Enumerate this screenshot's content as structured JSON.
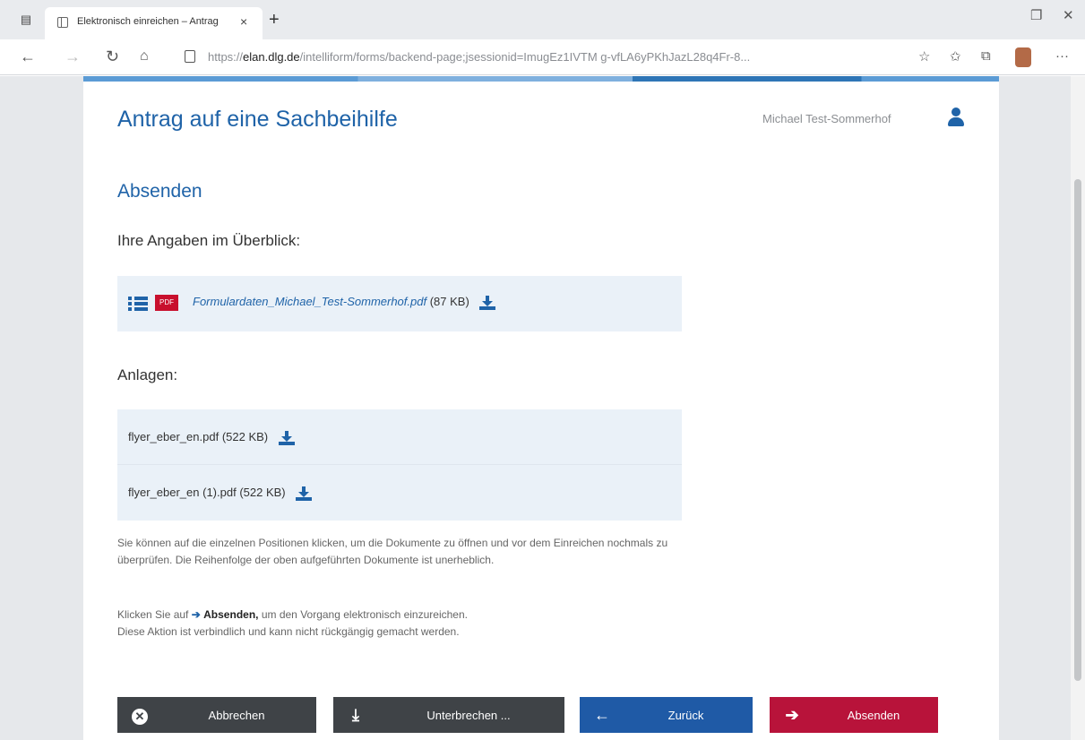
{
  "browser": {
    "tab_title": "Elektronisch einreichen – Antrag",
    "url_prefix": "https://",
    "url_domain": "elan.dlg.de",
    "url_path": "/intelliform/forms/backend-page;jsessionid=ImugEz1IVTM g-vfLA6yPKhJazL28q4Fr-8..."
  },
  "header": {
    "title": "Antrag auf eine Sachbeihilfe",
    "user_name": "Michael Test-Sommerhof"
  },
  "section": {
    "title": "Absenden",
    "overview_label": "Ihre Angaben im Überblick:",
    "attachments_label": "Anlagen:"
  },
  "form_data_file": {
    "name": "Formulardaten_Michael_Test-Sommerhof.pdf",
    "size": "(87 KB)",
    "badge": "PDF"
  },
  "attachments": [
    {
      "name": "flyer_eber_en.pdf",
      "size": "(522 KB)"
    },
    {
      "name": "flyer_eber_en (1).pdf",
      "size": "(522 KB)"
    }
  ],
  "info": {
    "paragraph1": "Sie können auf die einzelnen Positionen klicken, um die Dokumente zu öffnen und vor dem Einreichen nochmals zu überprüfen. Die Reihenfolge der oben aufgeführten Dokumente ist unerheblich.",
    "p2_prefix": "Klicken Sie auf",
    "p2_action": "Absenden,",
    "p2_suffix": "um den Vorgang elektronisch einzureichen.",
    "p2_line2": "Diese Aktion ist verbindlich und kann nicht rückgängig gemacht werden."
  },
  "buttons": {
    "cancel": "Abbrechen",
    "interrupt": "Unterbrechen ...",
    "back": "Zurück",
    "submit": "Absenden"
  },
  "colors": {
    "primary_blue": "#1f63a8",
    "submit_red": "#b8133a",
    "dark_button": "#3f4347"
  }
}
